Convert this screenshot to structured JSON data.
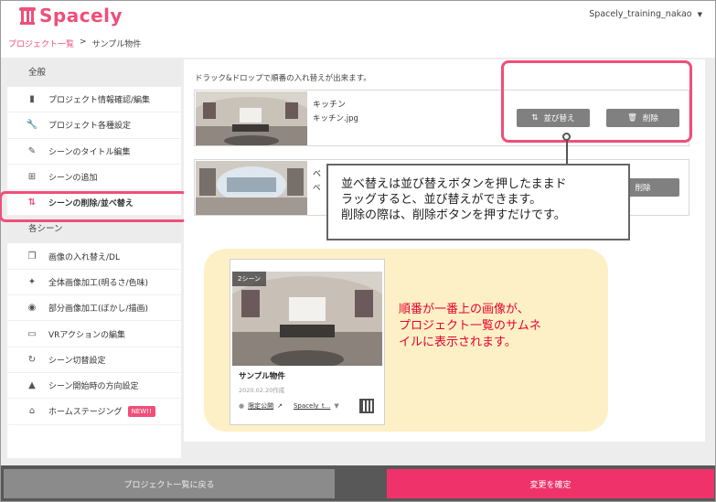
{
  "app": {
    "brand": "Spacely",
    "user": "Spacely_training_nakao"
  },
  "breadcrumb": {
    "parent": "プロジェクト一覧",
    "separator": ">",
    "current": "サンプル物件"
  },
  "sidebar": {
    "section_general": "全般",
    "general_items": [
      {
        "label": "プロジェクト情報確認/編集",
        "icon": "document-icon"
      },
      {
        "label": "プロジェクト各種設定",
        "icon": "wrench-icon"
      },
      {
        "label": "シーンのタイトル編集",
        "icon": "pencil-icon"
      },
      {
        "label": "シーンの追加",
        "icon": "plus-square-icon"
      },
      {
        "label": "シーンの削除/並べ替え",
        "icon": "sort-arrows-icon"
      }
    ],
    "section_scenes": "各シーン",
    "scene_items": [
      {
        "label": "画像の入れ替え/DL",
        "icon": "images-icon"
      },
      {
        "label": "全体画像加工(明るさ/色味)",
        "icon": "magic-wand-icon"
      },
      {
        "label": "部分画像加工(ぼかし/描画)",
        "icon": "palette-icon"
      },
      {
        "label": "VRアクションの編集",
        "icon": "vr-goggles-icon"
      },
      {
        "label": "シーン切替設定",
        "icon": "refresh-icon"
      },
      {
        "label": "シーン開始時の方向設定",
        "icon": "direction-arrow-icon"
      },
      {
        "label": "ホームステージング",
        "icon": "home-icon",
        "badge": "NEW!!"
      }
    ]
  },
  "main": {
    "instruction": "ドラック&ドロップで順番の入れ替えが出来ます。",
    "scenes": [
      {
        "name": "キッチン",
        "file": "キッチン.jpg"
      },
      {
        "name": "ベ",
        "file": "ベ"
      }
    ],
    "sort_label": "並び替え",
    "delete_label": "削除"
  },
  "callout": {
    "line1": "並べ替えは並び替えボタンを押したままド",
    "line2": "ラッグすると、並び替えができます。",
    "line3": "削除の際は、削除ボタンを押すだけです。"
  },
  "card": {
    "badge": "2シーン",
    "title": "サンプル物件",
    "date": "2020.02.20作成",
    "visibility": "限定公開",
    "link": "Spacely_t...",
    "caret": "▼"
  },
  "note": {
    "line1": "順番が一番上の画像が、",
    "line2": "プロジェクト一覧のサムネ",
    "line3": "イルに表示されます。"
  },
  "footer": {
    "back_label": "プロジェクト一覧に戻る",
    "save_label": "変更を確定"
  },
  "colors": {
    "accent": "#ef4f7a",
    "save": "#f0326a",
    "note_text": "#e8002e",
    "panel": "#fdf0c6"
  }
}
